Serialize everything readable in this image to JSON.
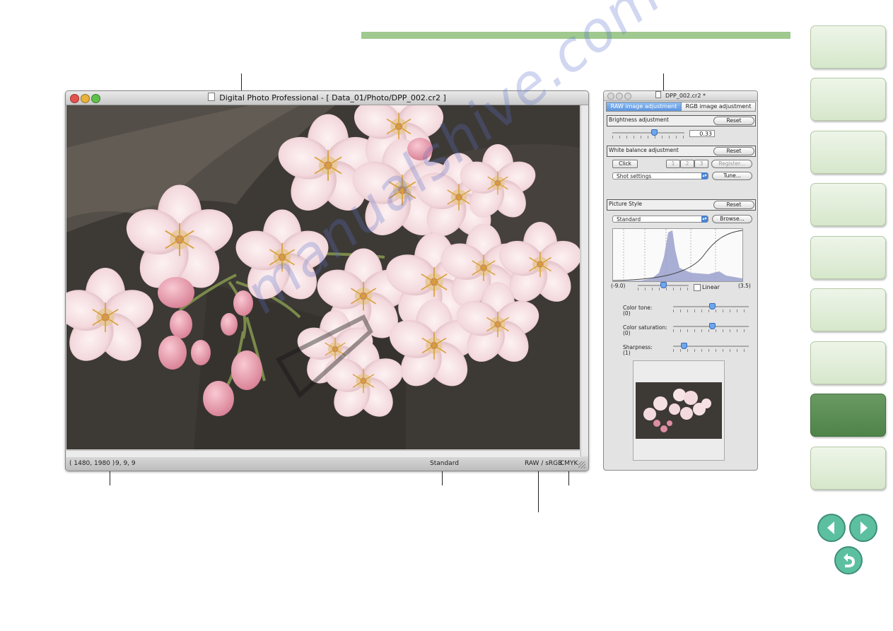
{
  "main_window": {
    "title": "Digital Photo Professional - [ Data_01/Photo/DPP_002.cr2 ]",
    "status": {
      "coords": "( 1480, 1980 )",
      "rgb_values": "9,  9,  9",
      "picture_style": "Standard",
      "color_space": "RAW / sRGB",
      "cmyk": "CMYK"
    }
  },
  "palette": {
    "title": "DPP_002.cr2 *",
    "tabs": [
      "RAW image adjustment",
      "RGB image adjustment"
    ],
    "brightness": {
      "label": "Brightness adjustment",
      "reset": "Reset",
      "value": "0.33",
      "slider_level": 0.55
    },
    "white_balance": {
      "label": "White balance adjustment",
      "reset": "Reset",
      "click": "Click",
      "presets": [
        "1",
        "2",
        "3"
      ],
      "register": "Register...",
      "select_value": "Shot settings",
      "tune": "Tune..."
    },
    "picture_style": {
      "label": "Picture Style",
      "reset": "Reset",
      "select_value": "Standard",
      "browse": "Browse...",
      "range_min": "(-9.0)",
      "range_max": "(3.5)",
      "linear_label": "Linear",
      "linear_checked": false,
      "color_tone": {
        "label": "Color tone:",
        "value": "(0)",
        "level": 0.5
      },
      "color_saturation": {
        "label": "Color saturation:",
        "value": "(0)",
        "level": 0.5
      },
      "sharpness": {
        "label": "Sharpness:",
        "value": "(1)",
        "level": 0.1
      }
    }
  },
  "watermark": "manualshive.com",
  "colors": {
    "accent_green": "#9fc98f",
    "nav_active": "#5a8c53",
    "tab_active": "#6fa6ea"
  }
}
